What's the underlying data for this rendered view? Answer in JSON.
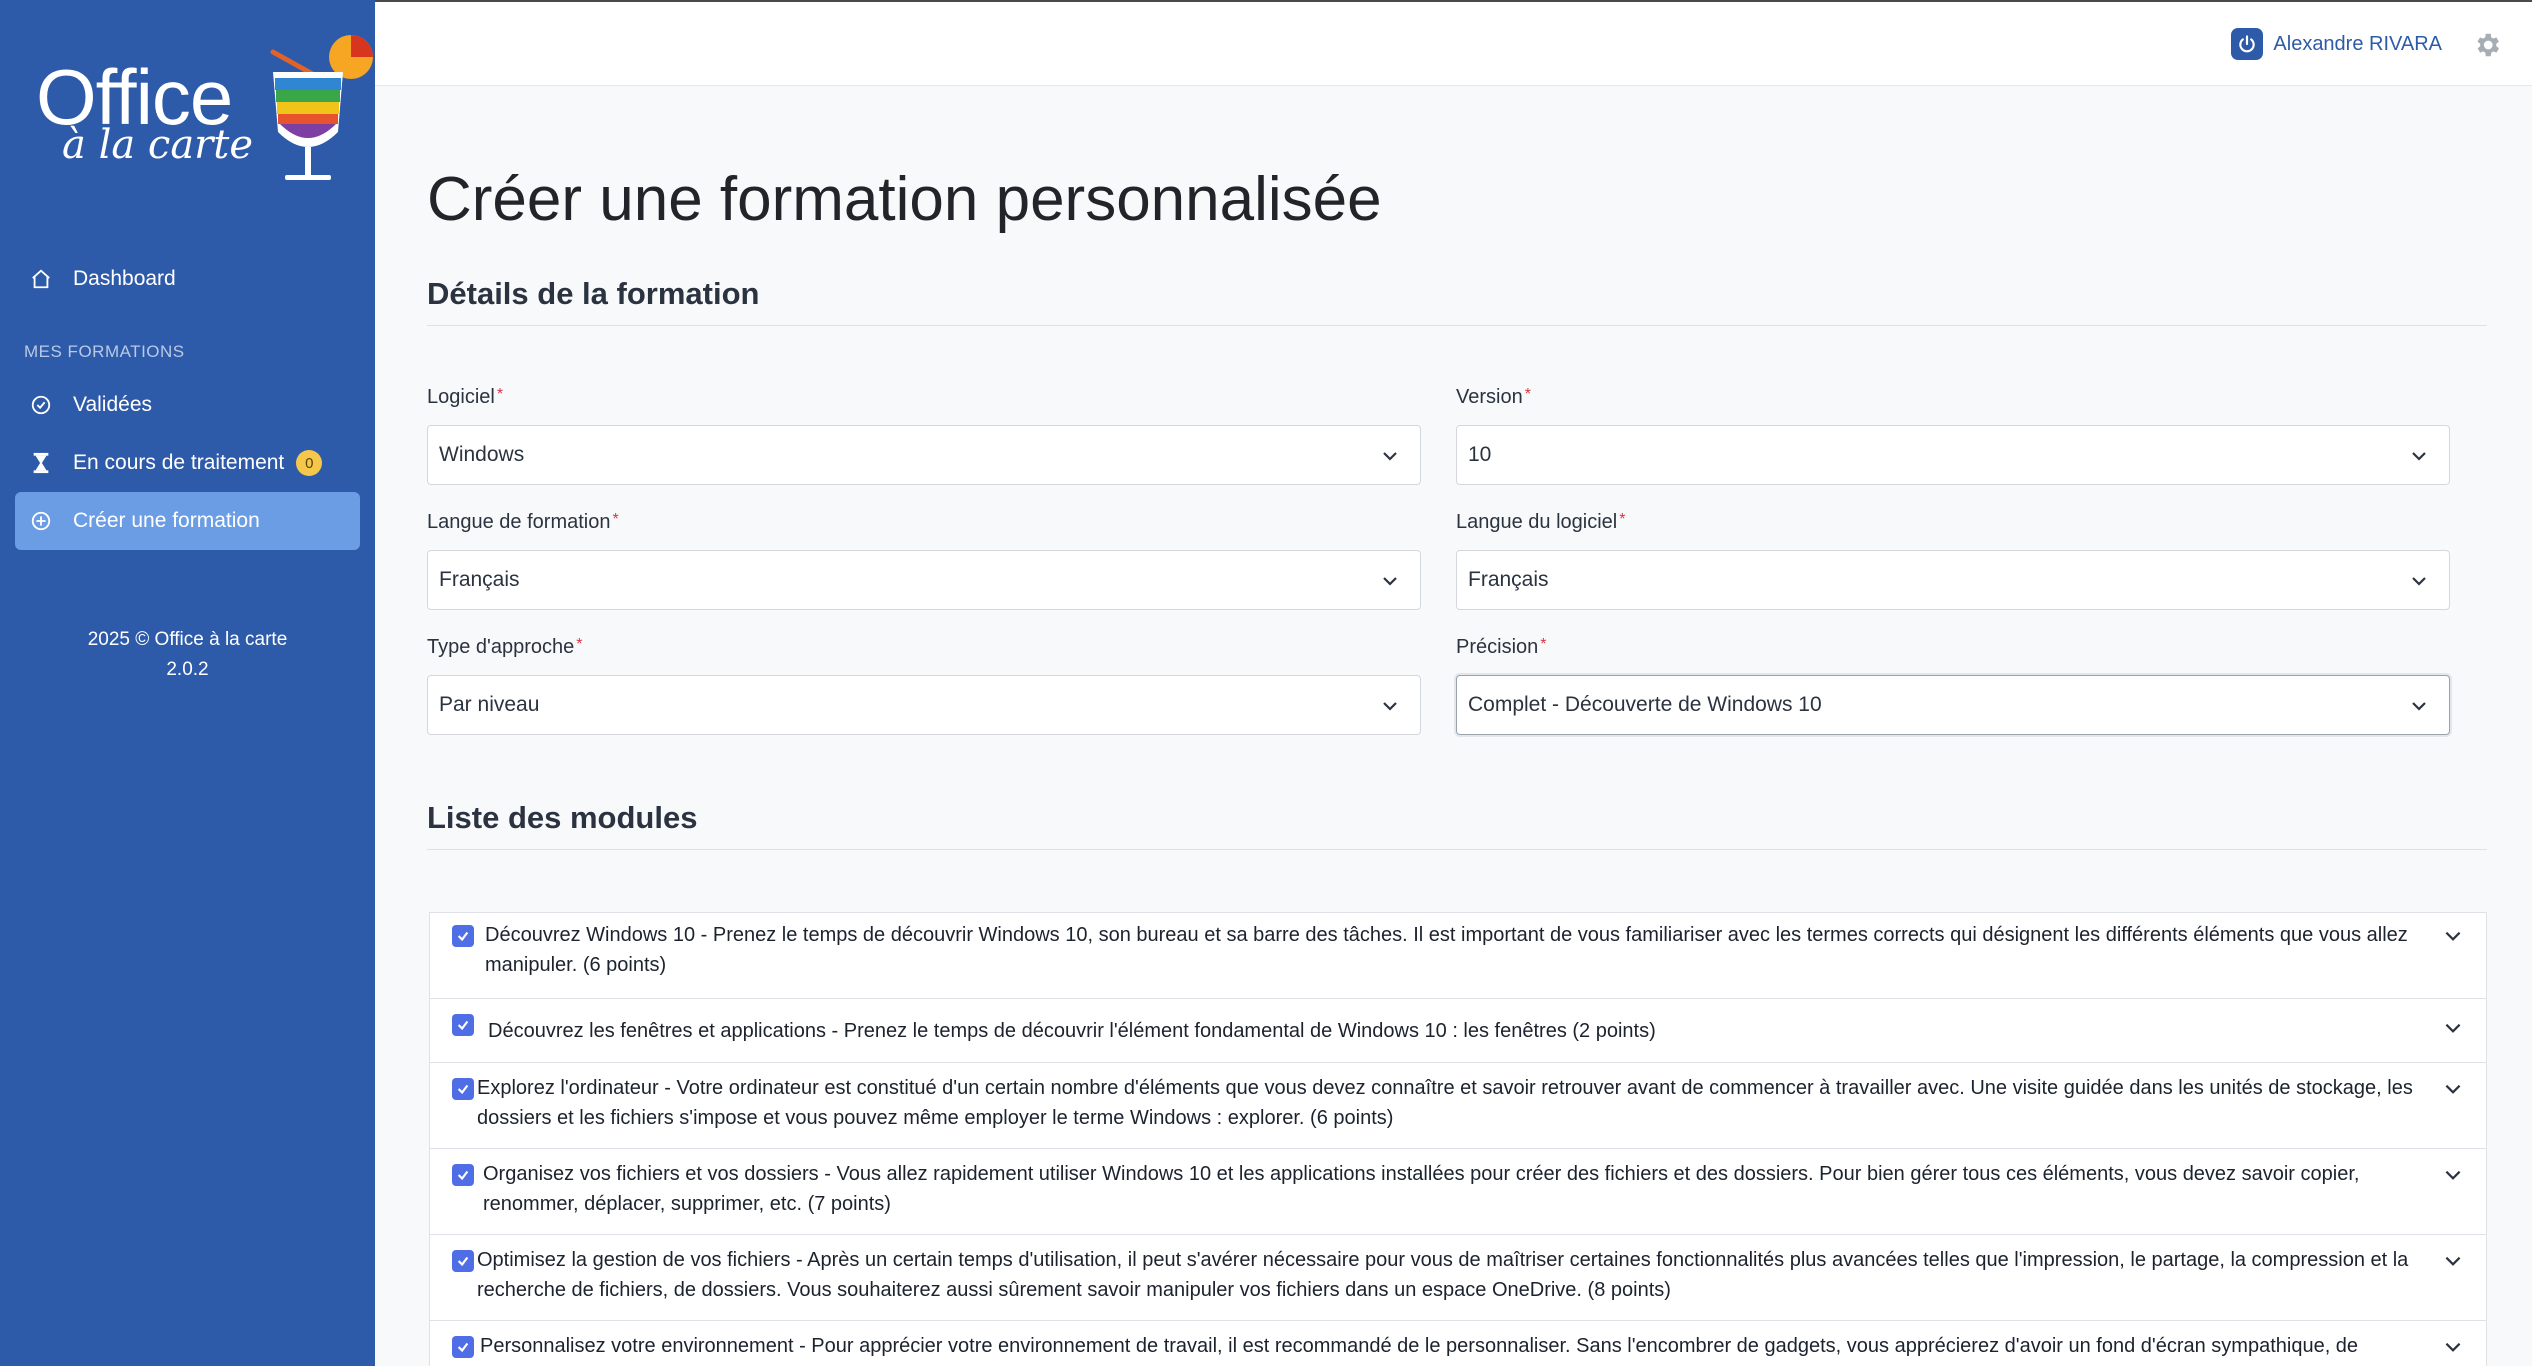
{
  "brand": {
    "name_line1": "Office",
    "name_line2": "à la carte"
  },
  "sidebar": {
    "dashboard_label": "Dashboard",
    "section_label": "MES FORMATIONS",
    "items": [
      {
        "label": "Validées",
        "icon": "check-circle-icon"
      },
      {
        "label": "En cours de traitement",
        "icon": "hourglass-icon",
        "badge": "0"
      },
      {
        "label": "Créer une formation",
        "icon": "plus-circle-icon",
        "active": true
      }
    ],
    "footer_line1": "2025 © Office à la carte",
    "footer_line2": "2.0.2"
  },
  "header": {
    "user_name": "Alexandre RIVARA"
  },
  "main": {
    "page_title": "Créer une formation personnalisée",
    "details_title": "Détails de la formation",
    "fields": {
      "logiciel": {
        "label": "Logiciel",
        "value": "Windows"
      },
      "version": {
        "label": "Version",
        "value": "10"
      },
      "langue_formation": {
        "label": "Langue de formation",
        "value": "Français"
      },
      "langue_logiciel": {
        "label": "Langue du logiciel",
        "value": "Français"
      },
      "type_approche": {
        "label": "Type d'approche",
        "value": "Par niveau"
      },
      "precision": {
        "label": "Précision",
        "value": "Complet - Découverte de Windows 10"
      }
    },
    "required_mark": "*",
    "modules_title": "Liste des modules",
    "modules": [
      {
        "text": "Découvrez Windows 10 - Prenez le temps de découvrir Windows 10, son bureau et sa barre des tâches. Il est important de vous familiariser avec les termes corrects qui désignent les différents éléments que vous allez manipuler. (6 points)",
        "checked": true
      },
      {
        "text": "Découvrez les fenêtres et applications - Prenez le temps de découvrir l'élément fondamental de Windows 10 : les fenêtres (2 points)",
        "checked": true
      },
      {
        "text": "Explorez l'ordinateur - Votre ordinateur est constitué d'un certain nombre d'éléments que vous devez connaître et savoir retrouver avant de commencer à travailler avec. Une visite guidée dans les unités de stockage, les dossiers et les fichiers s'impose et vous pouvez même employer le terme Windows : explorer. (6 points)",
        "checked": true
      },
      {
        "text": "Organisez vos fichiers et vos dossiers - Vous allez rapidement utiliser Windows 10 et les applications installées pour créer des fichiers et des dossiers. Pour bien gérer tous ces éléments, vous devez savoir copier, renommer, déplacer, supprimer, etc. (7 points)",
        "checked": true
      },
      {
        "text": "Optimisez la gestion de vos fichiers - Après un certain temps d'utilisation, il peut s'avérer nécessaire pour vous de maîtriser certaines fonctionnalités plus avancées telles que l'impression, le partage, la compression et la recherche de fichiers, de dossiers. Vous souhaiterez aussi sûrement savoir manipuler vos fichiers dans un espace OneDrive. (8 points)",
        "checked": true
      },
      {
        "text": "Personnalisez votre environnement - Pour apprécier votre environnement de travail, il est recommandé de le personnaliser. Sans l'encombrer de gadgets, vous apprécierez d'avoir un fond d'écran sympathique, de",
        "checked": true
      }
    ]
  },
  "colors": {
    "sidebar": "#2e5ba9",
    "active_item": "#6b9de4",
    "checkbox": "#4f6ee5",
    "required": "#dc3545",
    "badge": "#f5c84c"
  }
}
